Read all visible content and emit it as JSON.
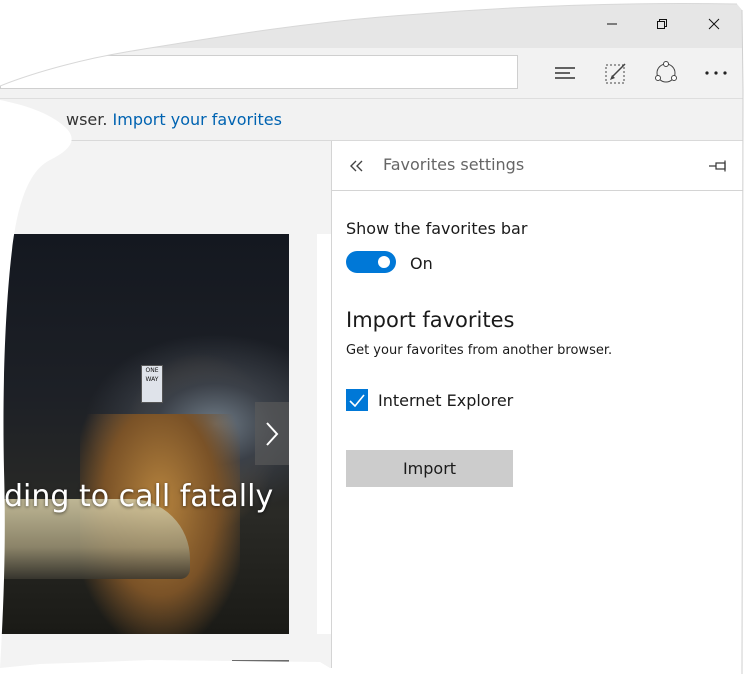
{
  "window": {
    "minimize_icon": "minimize-icon",
    "restore_icon": "restore-icon",
    "close_icon": "close-icon"
  },
  "toolbar": {
    "address_value": "",
    "icons": [
      "hub-icon",
      "web-note-icon",
      "share-icon",
      "more-icon"
    ]
  },
  "infobar": {
    "text_prefix": "wser. ",
    "link": "Import your favorites"
  },
  "page": {
    "headline": "ding to call fatally",
    "sign_text": "ONE WAY",
    "next_icon": "chevron-right-icon"
  },
  "panel": {
    "title": "Favorites settings",
    "back_icon": "double-chevron-left-icon",
    "pin_icon": "pin-icon",
    "show_bar_label": "Show the favorites bar",
    "toggle_state": "On",
    "import_heading": "Import favorites",
    "import_desc": "Get your favorites from another browser.",
    "browser_option": "Internet Explorer",
    "browser_checked": true,
    "import_button": "Import"
  },
  "colors": {
    "accent": "#0078d7",
    "link": "#0063b1",
    "button_gray": "#cccccc"
  }
}
